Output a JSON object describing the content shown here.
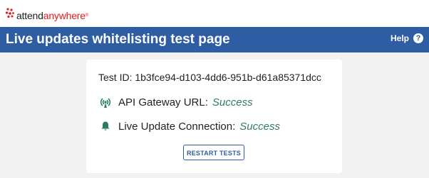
{
  "brand": {
    "logo_part1": "attend",
    "logo_part2": "anywhere",
    "logo_reg": "®"
  },
  "header": {
    "title": "Live updates whitelisting test page",
    "help_label": "Help",
    "help_icon": "?"
  },
  "card": {
    "test_id_label": "Test ID:",
    "test_id_value": "1b3fce94-d103-4dd6-951b-d61a85371dcc",
    "rows": [
      {
        "label": "API Gateway URL:",
        "status": "Success",
        "icon": "antenna-icon"
      },
      {
        "label": "Live Update Connection:",
        "status": "Success",
        "icon": "bell-icon"
      }
    ],
    "restart_label": "RESTART TESTS"
  },
  "colors": {
    "header_bg": "#2f5da3",
    "success": "#2e7d5b",
    "brand_red": "#e11b22",
    "icon_green": "#2e7d5b"
  }
}
